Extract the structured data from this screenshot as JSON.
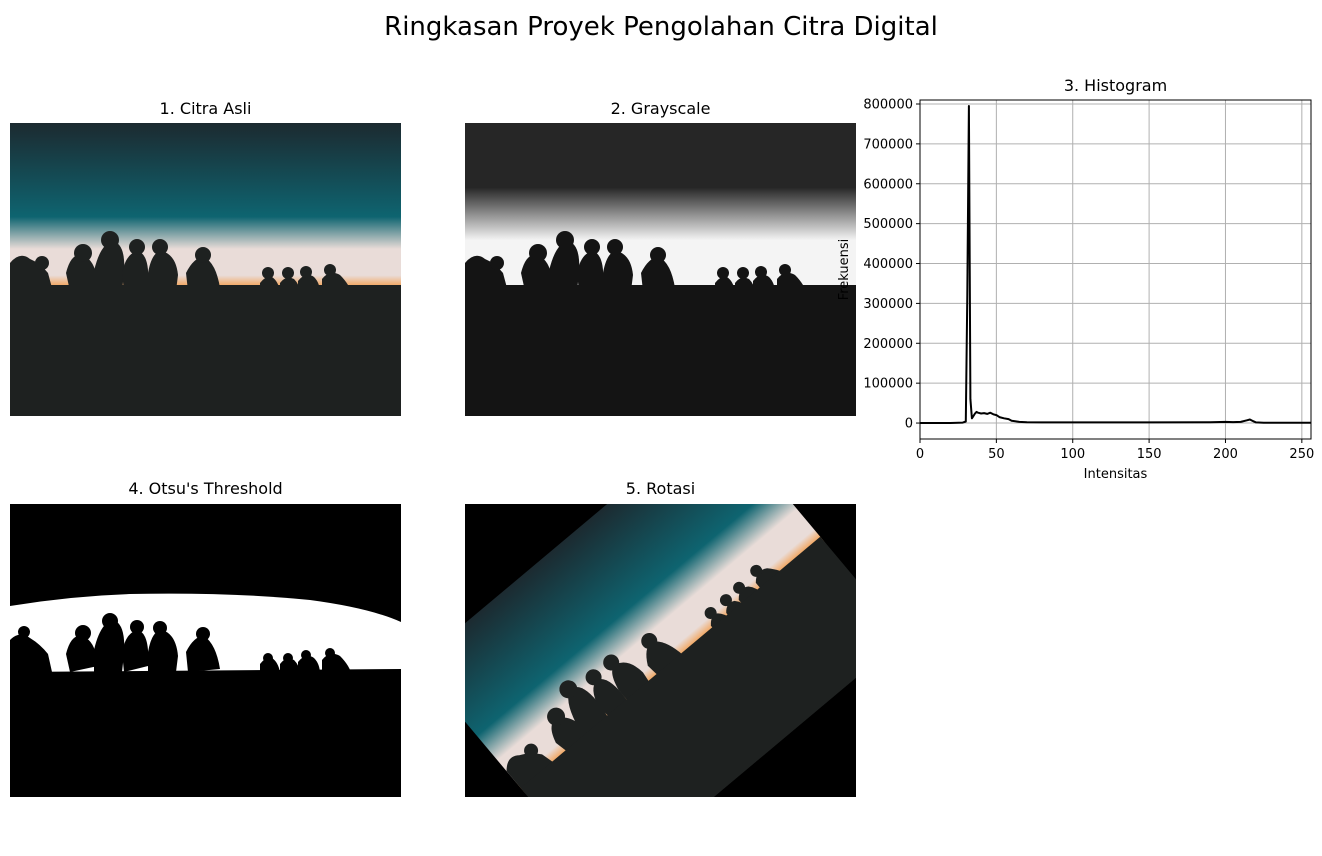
{
  "figure": {
    "title": "Ringkasan Proyek Pengolahan Citra Digital"
  },
  "panels": {
    "original": {
      "title": "1. Citra Asli"
    },
    "grayscale": {
      "title": "2. Grayscale"
    },
    "histogram": {
      "title": "3. Histogram"
    },
    "otsu": {
      "title": "4. Otsu's Threshold"
    },
    "rotation": {
      "title": "5. Rotasi"
    }
  },
  "colors": {
    "sky_top": "#1c2a30",
    "sky_teal": "#0e6470",
    "horizon_light": "#e9dcd8",
    "horizon_orange": "#f3a052",
    "ground": "#1e2120",
    "gray_top": "#262626",
    "gray_light": "#f4f4f4",
    "gray_ground": "#141414",
    "hist_line": "#000000",
    "grid": "#b0b0b0"
  },
  "chart_data": {
    "type": "line",
    "title": "3. Histogram",
    "xlabel": "Intensitas",
    "ylabel": "Frekuensi",
    "xlim": [
      0,
      256
    ],
    "ylim": [
      -40000,
      810000
    ],
    "xticks": [
      0,
      50,
      100,
      150,
      200,
      250
    ],
    "yticks": [
      0,
      100000,
      200000,
      300000,
      400000,
      500000,
      600000,
      700000,
      800000
    ],
    "grid": true,
    "series": [
      {
        "x": [
          0,
          10,
          20,
          28,
          30,
          31,
          32,
          33,
          34,
          35,
          36,
          37,
          38,
          40,
          42,
          44,
          46,
          48,
          50,
          52,
          55,
          58,
          60,
          65,
          70,
          80,
          100,
          150,
          190,
          200,
          205,
          210,
          214,
          216,
          218,
          220,
          225,
          230,
          240,
          256
        ],
        "values": [
          0,
          0,
          0,
          1000,
          4000,
          320000,
          795000,
          60000,
          12000,
          18000,
          24000,
          28000,
          26000,
          24000,
          25000,
          23000,
          26000,
          22000,
          20000,
          15000,
          12000,
          10000,
          6000,
          3000,
          2000,
          1500,
          1500,
          1500,
          2000,
          3000,
          2500,
          3000,
          7000,
          9000,
          5000,
          1500,
          500,
          500,
          500,
          500
        ]
      }
    ]
  }
}
